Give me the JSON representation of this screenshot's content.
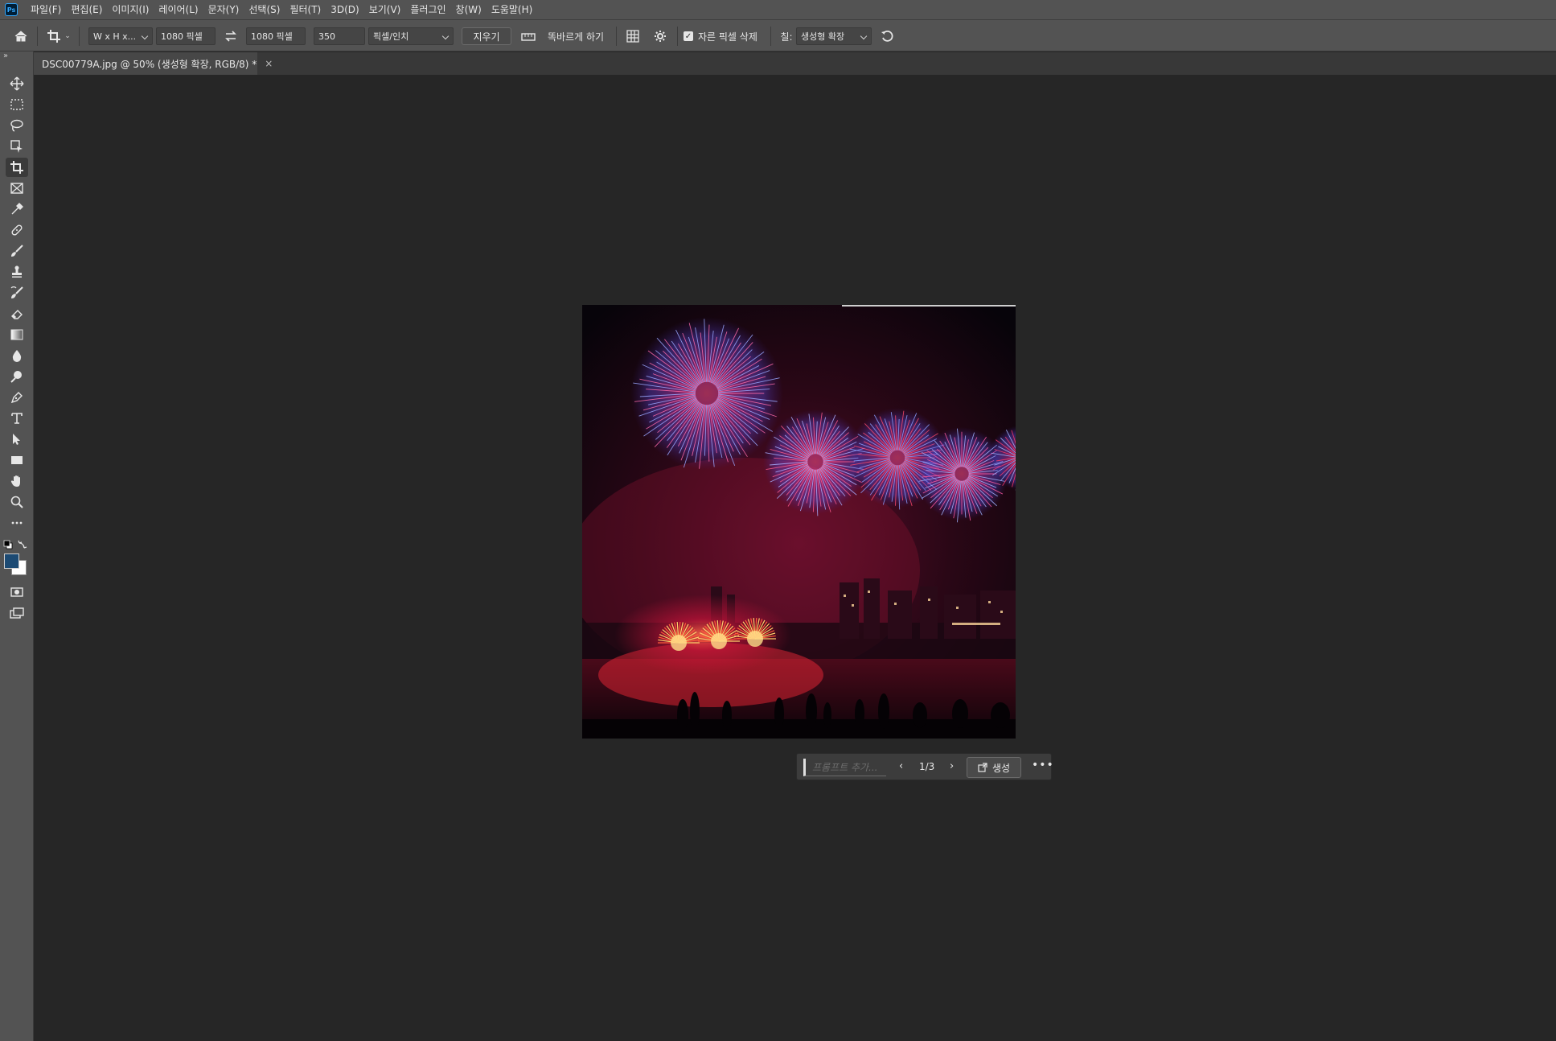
{
  "app": {
    "logo_text": "Ps"
  },
  "menu": [
    "파일(F)",
    "편집(E)",
    "이미지(I)",
    "레이어(L)",
    "문자(Y)",
    "선택(S)",
    "필터(T)",
    "3D(D)",
    "보기(V)",
    "플러그인",
    "창(W)",
    "도움말(H)"
  ],
  "options": {
    "ratio_preset": "W x H x...",
    "width_value": "1080 픽셀",
    "height_value": "1080 픽셀",
    "resolution_value": "350",
    "resolution_unit": "픽셀/인치",
    "clear_label": "지우기",
    "straighten_label": "똑바르게 하기",
    "delete_cropped_label": "자른 픽셀 삭제",
    "delete_cropped_checked": true,
    "fill_label": "칠:",
    "fill_value": "생성형 확장"
  },
  "document": {
    "tab_title": "DSC00779A.jpg @ 50% (생성형 확장, RGB/8) *",
    "close_glyph": "×"
  },
  "tools": [
    "move",
    "marquee",
    "lasso",
    "object-select",
    "crop",
    "frame",
    "eyedropper",
    "healing",
    "brush",
    "stamp",
    "history-brush",
    "eraser",
    "gradient",
    "blur",
    "dodge",
    "pen",
    "type",
    "path-select",
    "rectangle",
    "hand",
    "zoom",
    "more"
  ],
  "colors": {
    "foreground": "#1c4a73",
    "background": "#ffffff"
  },
  "generative_bar": {
    "prompt_placeholder": "프롬프트 추가...",
    "counter": "1/3",
    "generate_label": "생성"
  }
}
